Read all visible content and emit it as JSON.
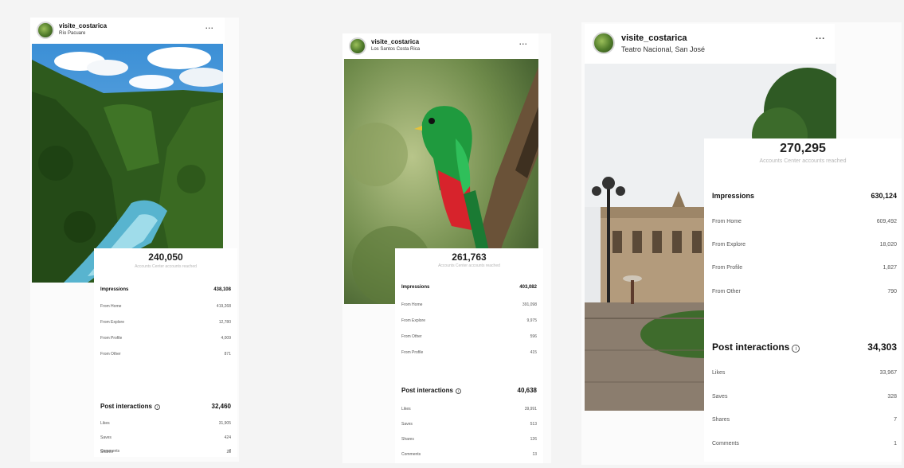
{
  "posts": [
    {
      "username": "visite_costarica",
      "location": "Río Pacuare",
      "more": "...",
      "reach": {
        "value": "240,050",
        "label": "Accounts Center accounts reached"
      },
      "impressions": {
        "label": "Impressions",
        "value": "438,108"
      },
      "impression_rows": [
        {
          "label": "From Home",
          "value": "419,268"
        },
        {
          "label": "From Explore",
          "value": "12,780"
        },
        {
          "label": "From Profile",
          "value": "4,009"
        },
        {
          "label": "From Other",
          "value": "871"
        }
      ],
      "interactions": {
        "label": "Post interactions",
        "value": "32,460"
      },
      "interaction_rows": [
        {
          "label": "Likes",
          "value": "31,905"
        },
        {
          "label": "Saves",
          "value": "424"
        },
        {
          "label": "Shares",
          "value": "28"
        },
        {
          "label": "Comments",
          "value": "7"
        }
      ]
    },
    {
      "username": "visite_costarica",
      "location": "Los Santos Costa Rica",
      "more": "...",
      "reach": {
        "value": "261,763",
        "label": "Accounts Center accounts reached"
      },
      "impressions": {
        "label": "Impressions",
        "value": "403,082"
      },
      "impression_rows": [
        {
          "label": "From Home",
          "value": "391,098"
        },
        {
          "label": "From Explore",
          "value": "9,975"
        },
        {
          "label": "From Other",
          "value": "596"
        },
        {
          "label": "From Profile",
          "value": "415"
        }
      ],
      "interactions": {
        "label": "Post interactions",
        "value": "40,638"
      },
      "interaction_rows": [
        {
          "label": "Likes",
          "value": "39,991"
        },
        {
          "label": "Saves",
          "value": "513"
        },
        {
          "label": "Shares",
          "value": "126"
        },
        {
          "label": "Comments",
          "value": "13"
        }
      ]
    },
    {
      "username": "visite_costarica",
      "location": "Teatro Nacional, San José",
      "more": "...",
      "reach": {
        "value": "270,295",
        "label": "Accounts Center accounts reached"
      },
      "impressions": {
        "label": "Impressions",
        "value": "630,124"
      },
      "impression_rows": [
        {
          "label": "From Home",
          "value": "609,492"
        },
        {
          "label": "From Explore",
          "value": "18,020"
        },
        {
          "label": "From Profile",
          "value": "1,827"
        },
        {
          "label": "From Other",
          "value": "790"
        }
      ],
      "interactions": {
        "label": "Post interactions",
        "value": "34,303"
      },
      "interaction_rows": [
        {
          "label": "Likes",
          "value": "33,967"
        },
        {
          "label": "Saves",
          "value": "328"
        },
        {
          "label": "Shares",
          "value": "7"
        },
        {
          "label": "Comments",
          "value": "1"
        }
      ]
    }
  ]
}
